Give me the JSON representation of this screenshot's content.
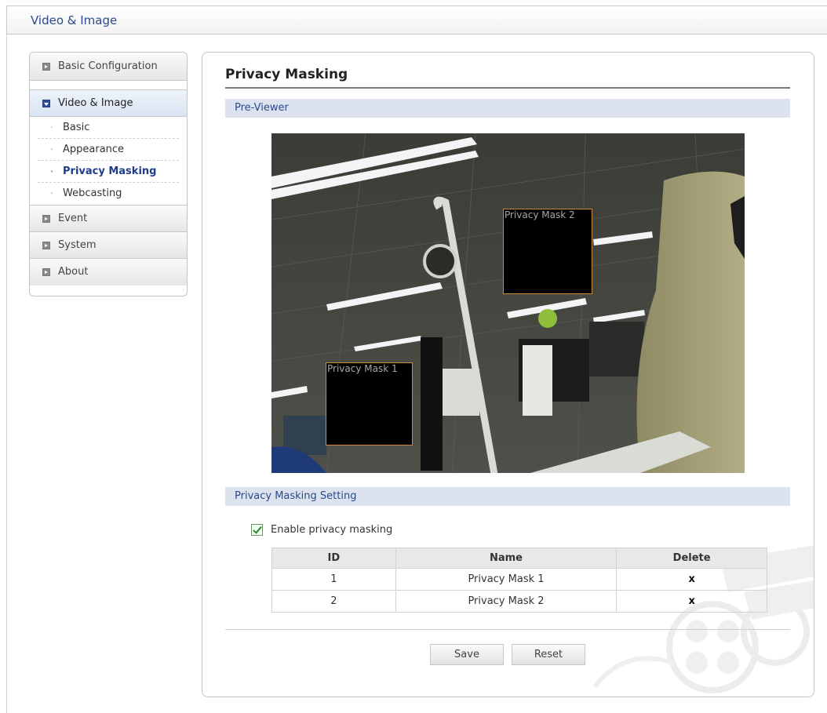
{
  "header": {
    "title": "Video & Image"
  },
  "sidebar": {
    "sections": [
      {
        "label": "Basic Configuration"
      },
      {
        "label": "Video & Image"
      },
      {
        "label": "Event"
      },
      {
        "label": "System"
      },
      {
        "label": "About"
      }
    ],
    "sub_items": [
      {
        "label": "Basic"
      },
      {
        "label": "Appearance"
      },
      {
        "label": "Privacy Masking"
      },
      {
        "label": "Webcasting"
      }
    ]
  },
  "main": {
    "title": "Privacy Masking",
    "preview_section": "Pre-Viewer",
    "settings_section": "Privacy Masking Setting",
    "preview_masks": [
      {
        "label": "Privacy Mask 1"
      },
      {
        "label": "Privacy Mask 2"
      }
    ],
    "enable_label": "Enable privacy masking",
    "enable_checked": true,
    "table": {
      "headers": [
        "ID",
        "Name",
        "Delete"
      ],
      "rows": [
        {
          "id": "1",
          "name": "Privacy Mask 1",
          "delete": "x"
        },
        {
          "id": "2",
          "name": "Privacy Mask 2",
          "delete": "x"
        }
      ]
    },
    "buttons": {
      "save": "Save",
      "reset": "Reset"
    }
  },
  "colors": {
    "accent": "#2a4a8c",
    "section_bar": "#dde3ee",
    "mask_border": "#d08a3a"
  }
}
